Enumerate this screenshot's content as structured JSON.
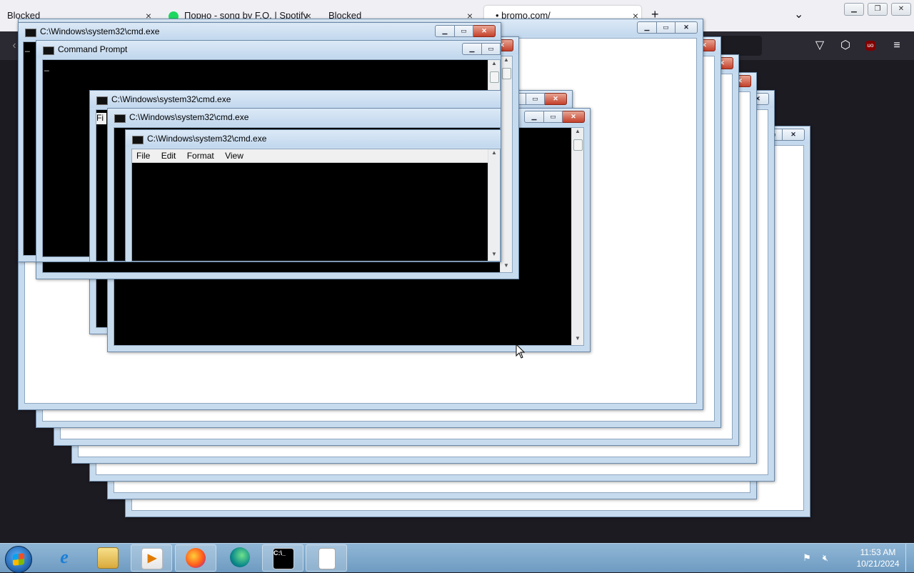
{
  "browser": {
    "tabs": [
      {
        "label": "Blocked"
      },
      {
        "label": "Порно - song by F.O. | Spotify"
      },
      {
        "label": "Blocked"
      },
      {
        "label": "• bromo.com/"
      }
    ],
    "new_tab": "+",
    "list_tabs": "⌄",
    "window_controls": {
      "minimize": "▁",
      "restore": "❐",
      "close": "✕"
    },
    "back_icon": "‹",
    "toolbar_icons": {
      "pocket": "▽",
      "extensions": "⬡",
      "ublock": "uo",
      "menu": "≡"
    }
  },
  "windows": [
    {
      "title": "C:\\Windows\\system32\\cmd.exe"
    },
    {
      "title": "Command Prompt"
    },
    {
      "title": "C:\\Windows\\system32\\cmd.exe"
    },
    {
      "title": "C:\\Windows\\system32\\cmd.exe"
    },
    {
      "title": "C:\\Windows\\system32\\cmd.exe"
    }
  ],
  "cursor_text": "_",
  "partial_menu": "Fi",
  "notepad_menu": [
    "File",
    "Edit",
    "Format",
    "View"
  ],
  "title_buttons": {
    "min": "▁",
    "max": "▭",
    "close": "✕"
  },
  "scroll_arrows": {
    "up": "▲",
    "down": "▼"
  },
  "taskbar": {
    "time": "11:53 AM",
    "date": "10/21/2024",
    "apps": [
      "Internet Explorer",
      "Windows Explorer",
      "Windows Media Player",
      "Firefox",
      "Edge",
      "Command Prompt",
      "Notepad"
    ]
  },
  "colors": {
    "accent": "#1ed760",
    "close": "#c4402b",
    "taskbar": "#7ea8cc"
  }
}
